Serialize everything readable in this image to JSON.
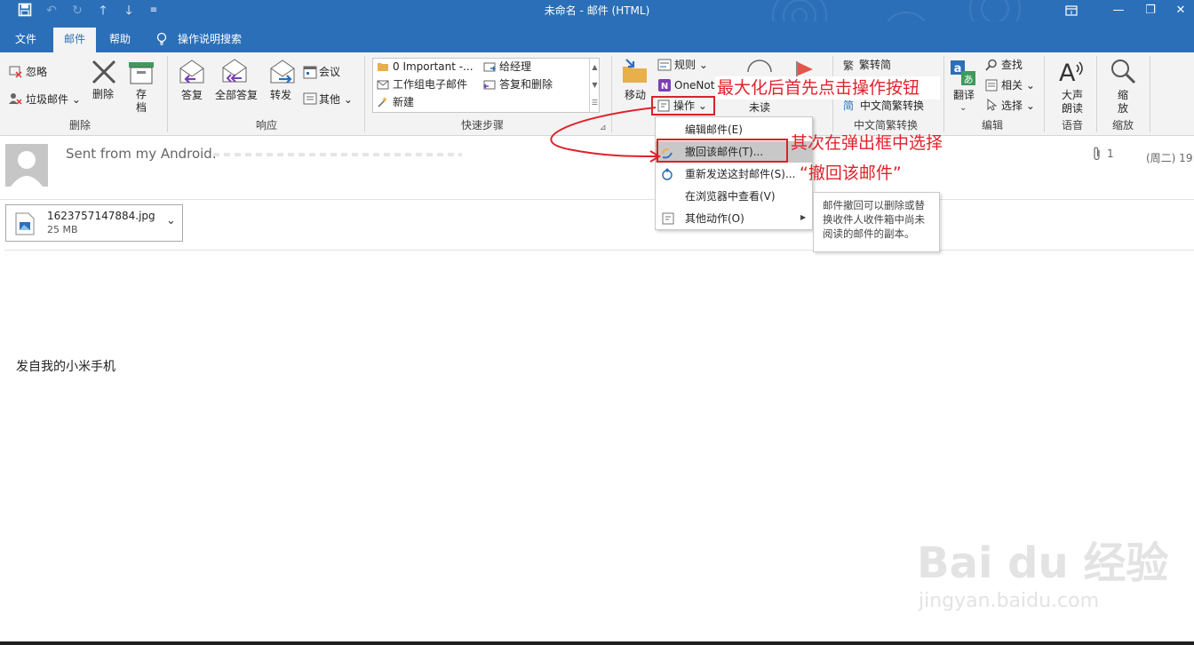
{
  "window": {
    "title": "未命名  -  邮件 (HTML)",
    "restore_label": "⊡",
    "maximize_label": "❐",
    "close_label": "✕"
  },
  "quick_access": {
    "save": "save-icon",
    "undo": "undo-icon",
    "redo": "redo-icon",
    "up": "up-arrow-icon",
    "down": "down-arrow-icon",
    "customize": "customize-icon"
  },
  "tabs": [
    {
      "label": "文件"
    },
    {
      "label": "邮件",
      "active": true
    },
    {
      "label": "帮助"
    }
  ],
  "search_label": "操作说明搜索",
  "ribbon": {
    "delete_group": {
      "ignore": "忽略",
      "junk": "垃圾邮件",
      "delete": "删除",
      "archive_line1": "存",
      "archive_line2": "档",
      "label": "删除"
    },
    "respond_group": {
      "reply": "答复",
      "reply_all": "全部答复",
      "forward": "转发",
      "meeting": "会议",
      "more": "其他",
      "label": "响应"
    },
    "quick_steps": {
      "items": [
        "0 Important -...",
        "工作组电子邮件",
        "新建",
        "给经理",
        "答复和删除"
      ],
      "label": "快速步骤"
    },
    "move_group": {
      "move": "移动",
      "rules": "规则",
      "onenote": "OneNote",
      "actions": "操作"
    },
    "tags_group": {
      "unread": "未读"
    },
    "chinese_group": {
      "to_simplified": "繁转简",
      "convert": "中文简繁转换",
      "label": "中文简繁转换"
    },
    "editing_group": {
      "translate": "翻译",
      "find": "查找",
      "related": "相关",
      "select": "选择",
      "label": "编辑"
    },
    "speech_group": {
      "read_line1": "大声",
      "read_line2": "朗读",
      "label": "语音"
    },
    "zoom_group": {
      "zoom_line1": "缩",
      "zoom_line2": "放",
      "label": "缩放"
    }
  },
  "menu": {
    "items": [
      {
        "label": "编辑邮件(E)"
      },
      {
        "label": "撤回该邮件(T)...",
        "selected": true
      },
      {
        "label": "重新发送这封邮件(S)..."
      },
      {
        "label": "在浏览器中查看(V)"
      },
      {
        "label": "其他动作(O)"
      }
    ],
    "tooltip": "邮件撤回可以删除或替换收件人收件箱中尚未阅读的邮件的副本。"
  },
  "annotations": {
    "step1": "最大化后首先点击操作按钮",
    "step2": "其次在弹出框中选择",
    "step3": "“撤回该邮件”"
  },
  "message": {
    "header_text": "Sent from my Android.",
    "attachment_count": "1",
    "date_partial": "(周二) 19:",
    "attachment_name": "1623757147884.jpg",
    "attachment_size": "25 MB",
    "body": "发自我的小米手机"
  },
  "watermark": {
    "brand": "Bai du 经验",
    "url": "jingyan.baidu.com"
  },
  "colors": {
    "accent": "#2b6fb8",
    "annotation": "#e0222a",
    "ribbon_bg": "#f3f3f3"
  }
}
